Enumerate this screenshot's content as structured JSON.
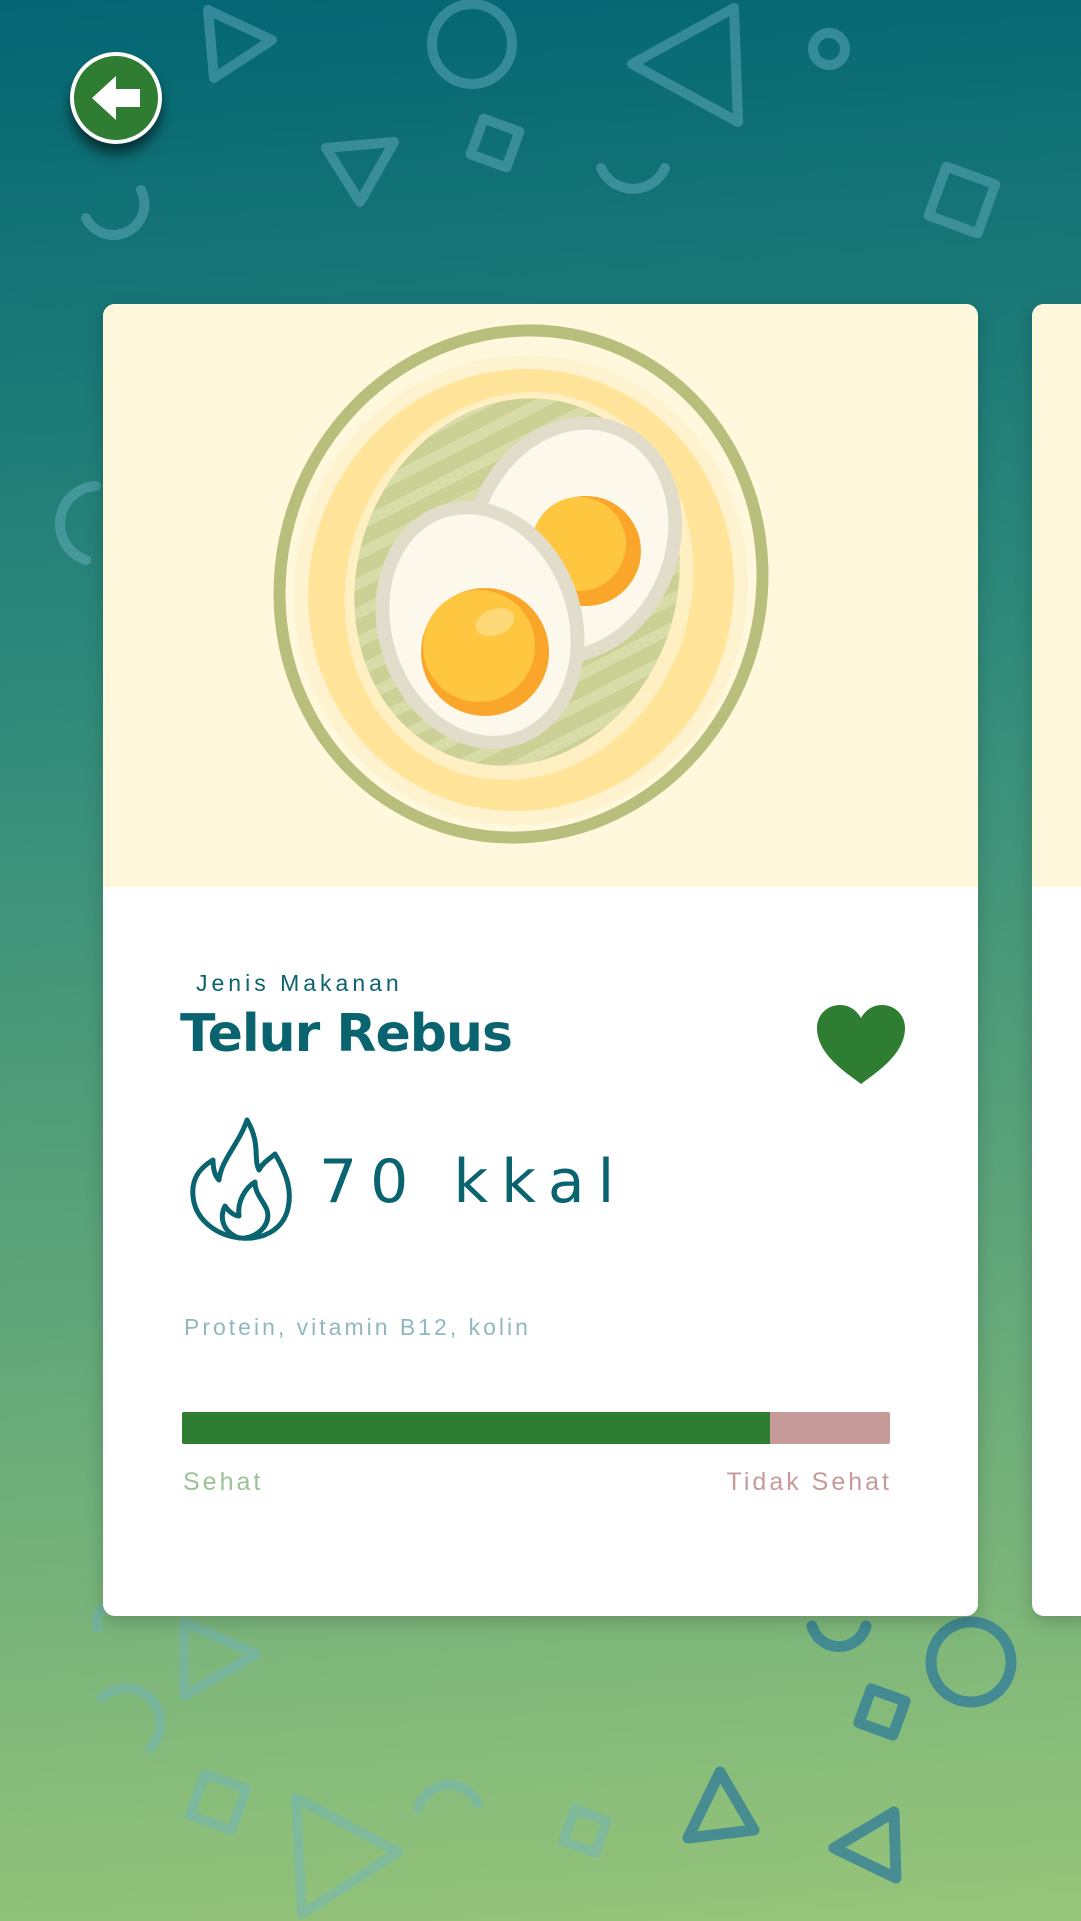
{
  "food": {
    "type_label": "Jenis Makanan",
    "name": "Telur Rebus",
    "calories": "70 kkal",
    "nutrients": "Protein, vitamin B12, kolin",
    "favorite": true
  },
  "health": {
    "healthy_label": "Sehat",
    "unhealthy_label": "Tidak Sehat",
    "healthy_fraction": 0.83
  },
  "colors": {
    "primary_teal": "#0a6470",
    "healthy_green": "#2e7d32",
    "unhealthy_pink": "#c79a9a",
    "card_image_bg": "#fff8dc"
  },
  "icons": {
    "back": "arrow-left-icon",
    "favorite": "heart-icon",
    "calories": "flame-icon"
  }
}
